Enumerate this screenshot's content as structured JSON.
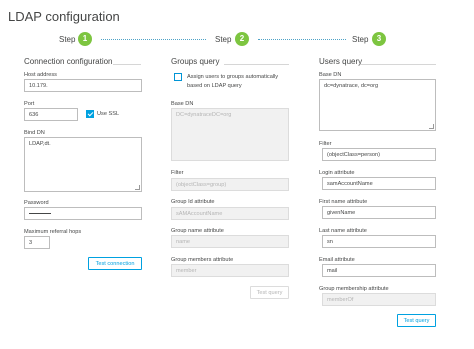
{
  "page": {
    "title": "LDAP configuration"
  },
  "steps": [
    {
      "label": "Step",
      "number": "1"
    },
    {
      "label": "Step",
      "number": "2"
    },
    {
      "label": "Step",
      "number": "3"
    }
  ],
  "connection": {
    "title": "Connection configuration",
    "host_label": "Host address",
    "host_value": "10.179.",
    "port_label": "Port",
    "port_value": "636",
    "ssl_label": "Use SSL",
    "ssl_checked": true,
    "bind_label": "Bind DN",
    "bind_value": "LDAP,dt.",
    "password_label": "Password",
    "hops_label": "Maximum referral hops",
    "hops_value": "3",
    "test_button": "Test connection"
  },
  "groups": {
    "title": "Groups query",
    "assign_label_line1": "Assign users to groups automatically",
    "assign_label_line2": "based on LDAP query",
    "base_label": "Base DN",
    "base_value": "DC=dynatraceDC=org",
    "filter_label": "Filter",
    "filter_value": "(objectClass=group)",
    "groupid_label": "Group Id attribute",
    "groupid_value": "sAMAccountName",
    "groupname_label": "Group name attribute",
    "groupname_value": "name",
    "members_label": "Group members attribute",
    "members_value": "member",
    "test_button": "Test query"
  },
  "users": {
    "title": "Users query",
    "base_label": "Base DN",
    "base_value": "dc=dynatrace, dc=org",
    "filter_label": "Filter",
    "filter_value": "(objectClass=person)",
    "login_label": "Login attribute",
    "login_value": "samAccountName",
    "firstname_label": "First name attribute",
    "firstname_value": "givenName",
    "lastname_label": "Last name attribute",
    "lastname_value": "sn",
    "email_label": "Email attribute",
    "email_value": "mail",
    "membership_label": "Group membership attribute",
    "membership_value": "memberOf",
    "test_button": "Test query"
  },
  "colors": {
    "step_active": "#7dc540",
    "accent": "#00a1e0",
    "text": "#454646"
  }
}
